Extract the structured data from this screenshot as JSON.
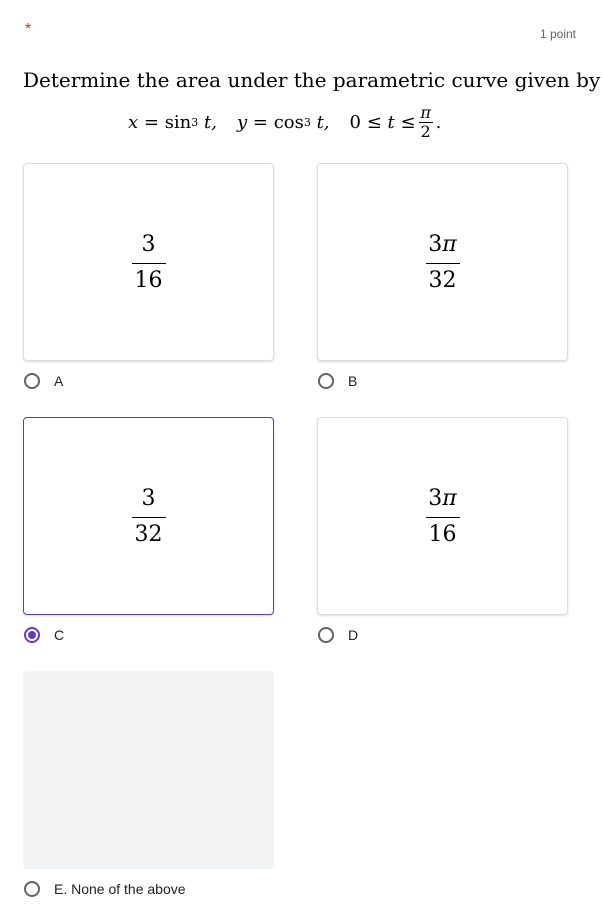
{
  "header": {
    "required_mark": "*",
    "points": "1 point"
  },
  "question": {
    "text": "Determine the area under the parametric curve given by",
    "formula": {
      "x_lhs": "x",
      "x_rhs": "sin",
      "x_power": "3",
      "x_var": "t,",
      "y_lhs": "y",
      "y_rhs": "cos",
      "y_power": "3",
      "y_var": "t,",
      "range_start": "0 ≤",
      "range_var": "t",
      "range_le": "≤",
      "range_num": "π",
      "range_den": "2",
      "end": "."
    }
  },
  "options": [
    {
      "letter": "A",
      "numerator": "3",
      "numerator_pi": "",
      "denominator": "16",
      "selected": false
    },
    {
      "letter": "B",
      "numerator": "3",
      "numerator_pi": "π",
      "denominator": "32",
      "selected": false
    },
    {
      "letter": "C",
      "numerator": "3",
      "numerator_pi": "",
      "denominator": "32",
      "selected": true
    },
    {
      "letter": "D",
      "numerator": "3",
      "numerator_pi": "π",
      "denominator": "16",
      "selected": false
    },
    {
      "letter": "E. None of the above",
      "selected": false
    }
  ],
  "colors": {
    "accent": "#673ab7",
    "required": "#d93025",
    "empty_card": "#f1f3f4"
  }
}
